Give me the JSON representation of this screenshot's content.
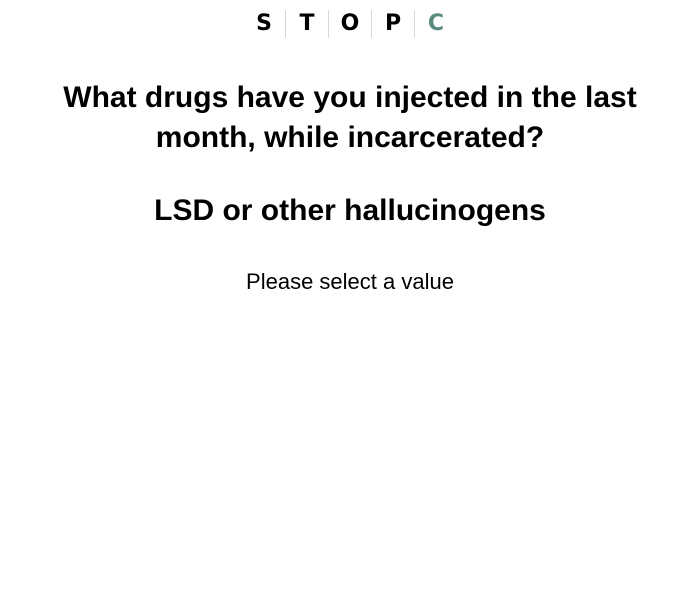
{
  "logo": {
    "letters": [
      "S",
      "T",
      "O",
      "P",
      "C"
    ],
    "accent_color": "#5a8a7e"
  },
  "question": {
    "text": "What drugs have you injected in the last month, while incarcerated?"
  },
  "option": {
    "text": "LSD or other hallucinogens"
  },
  "prompt": {
    "text": "Please select a value"
  }
}
